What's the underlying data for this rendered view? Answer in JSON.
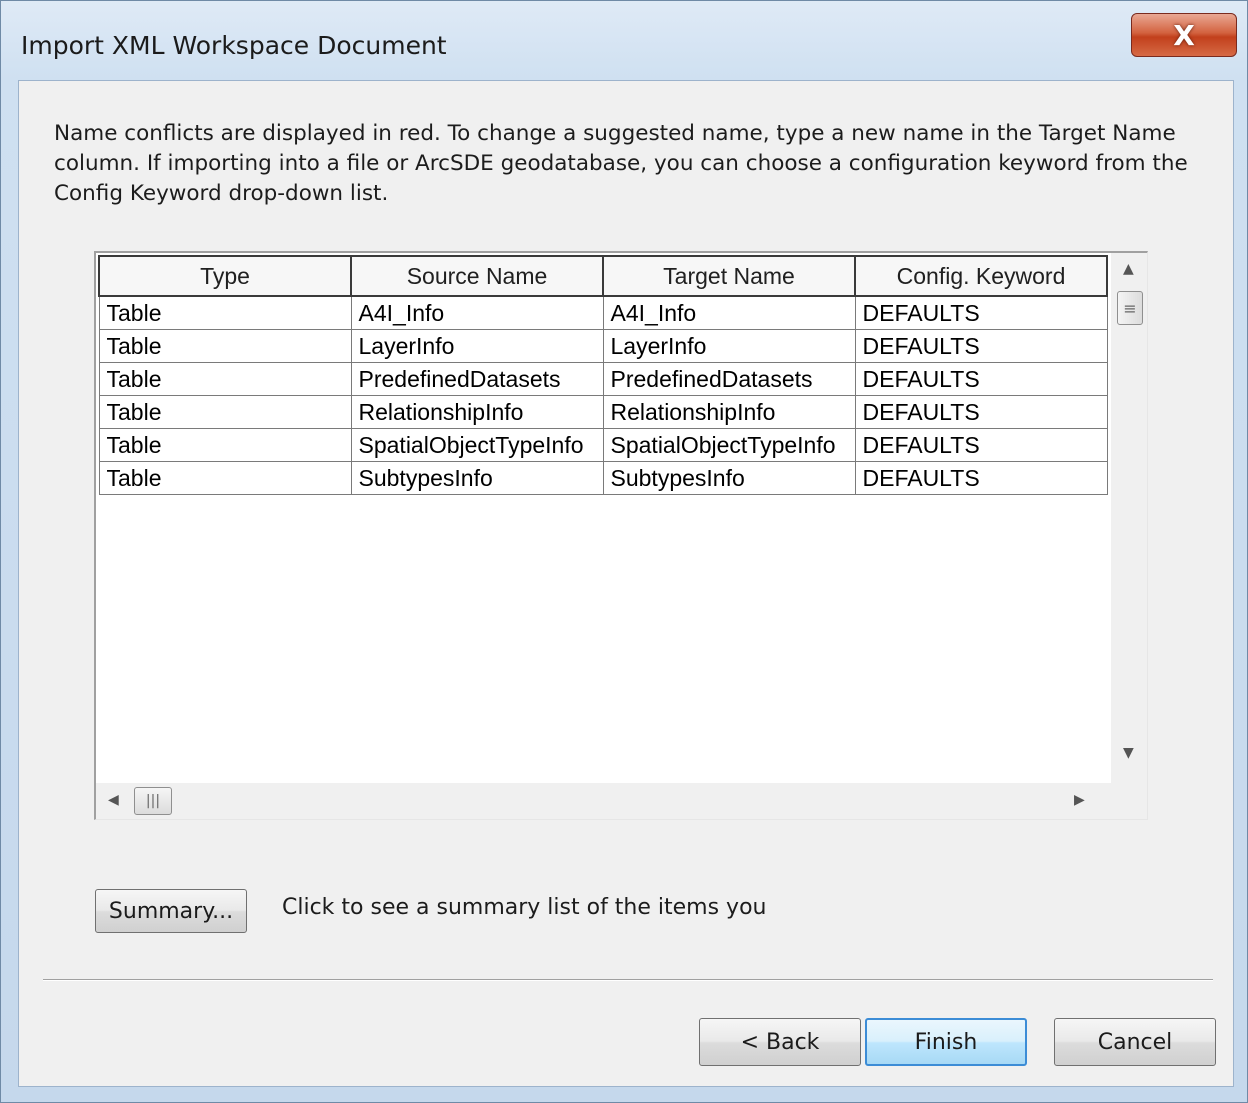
{
  "window": {
    "title": "Import XML Workspace Document",
    "close_glyph": "X"
  },
  "instructions": "Name conflicts are displayed in red. To change a suggested name, type a new name in the Target Name column. If importing into a file or ArcSDE geodatabase, you can choose a configuration keyword from the Config Keyword drop-down list.",
  "table": {
    "columns": [
      "Type",
      "Source Name",
      "Target Name",
      "Config. Keyword"
    ],
    "rows": [
      [
        "Table",
        "A4I_Info",
        "A4I_Info",
        "DEFAULTS"
      ],
      [
        "Table",
        "LayerInfo",
        "LayerInfo",
        "DEFAULTS"
      ],
      [
        "Table",
        "PredefinedDatasets",
        "PredefinedDatasets",
        "DEFAULTS"
      ],
      [
        "Table",
        "RelationshipInfo",
        "RelationshipInfo",
        "DEFAULTS"
      ],
      [
        "Table",
        "SpatialObjectTypeInfo",
        "SpatialObjectTypeInfo",
        "DEFAULTS"
      ],
      [
        "Table",
        "SubtypesInfo",
        "SubtypesInfo",
        "DEFAULTS"
      ]
    ]
  },
  "summary": {
    "button_label": "Summary...",
    "description": "Click to see a summary list of the items you"
  },
  "footer": {
    "back_label": "< Back",
    "finish_label": "Finish",
    "cancel_label": "Cancel"
  },
  "icons": {
    "scroll_up": "arrow-up-icon",
    "scroll_down": "arrow-down-icon",
    "scroll_left": "arrow-left-icon",
    "scroll_right": "arrow-right-icon"
  }
}
